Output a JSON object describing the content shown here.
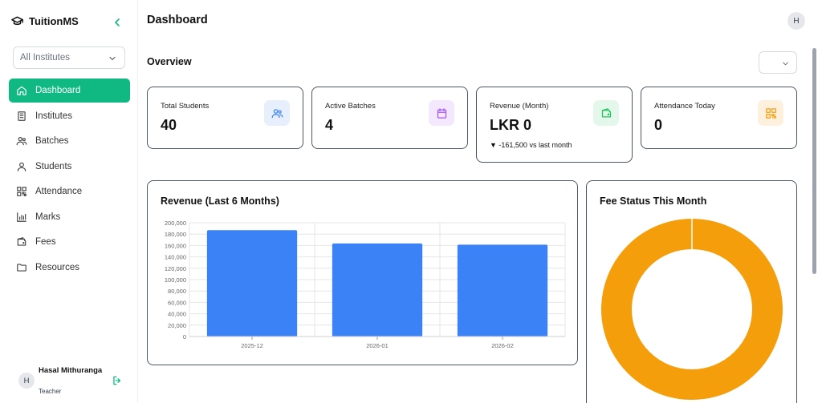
{
  "brand": {
    "name": "TuitionMS"
  },
  "sidebar": {
    "institute_select": {
      "value": "All Institutes"
    },
    "items": [
      {
        "label": "Dashboard",
        "icon": "home-icon",
        "active": true
      },
      {
        "label": "Institutes",
        "icon": "building-icon"
      },
      {
        "label": "Batches",
        "icon": "users-icon"
      },
      {
        "label": "Students",
        "icon": "user-icon"
      },
      {
        "label": "Attendance",
        "icon": "qr-icon"
      },
      {
        "label": "Marks",
        "icon": "bar-chart-icon"
      },
      {
        "label": "Fees",
        "icon": "wallet-icon"
      },
      {
        "label": "Resources",
        "icon": "folder-icon"
      }
    ],
    "user": {
      "initial": "H",
      "name": "Hasal Mithuranga",
      "role": "Teacher"
    }
  },
  "header": {
    "title": "Dashboard",
    "avatar_initial": "H"
  },
  "overview": {
    "title": "Overview",
    "select_value": ""
  },
  "stats": [
    {
      "label": "Total Students",
      "value": "40",
      "icon": "users-icon",
      "accent": "#3b82f6"
    },
    {
      "label": "Active Batches",
      "value": "4",
      "icon": "calendar-icon",
      "accent": "#a855f7"
    },
    {
      "label": "Revenue (Month)",
      "value": "LKR 0",
      "sub": "▼ -161,500 vs last month",
      "icon": "wallet-icon",
      "accent": "#22c55e"
    },
    {
      "label": "Attendance Today",
      "value": "0",
      "icon": "qr-icon",
      "accent": "#f59e0b"
    }
  ],
  "revenue_panel": {
    "title": "Revenue (Last 6 Months)"
  },
  "fee_panel": {
    "title": "Fee Status This Month"
  },
  "colors": {
    "primary": "#10b981",
    "bar": "#3b82f6",
    "donut": "#f59e0b"
  },
  "chart_data": [
    {
      "type": "bar",
      "title": "Revenue (Last 6 Months)",
      "categories": [
        "2025-12",
        "2026-01",
        "2026-02"
      ],
      "values": [
        187000,
        163500,
        161500
      ],
      "ylim": [
        0,
        200000
      ],
      "yticks": [
        "0",
        "20,000",
        "40,000",
        "60,000",
        "80,000",
        "100,000",
        "120,000",
        "140,000",
        "160,000",
        "180,000",
        "200,000"
      ],
      "grid": true,
      "color": "#3b82f6"
    },
    {
      "type": "pie",
      "title": "Fee Status This Month",
      "values": [
        100
      ],
      "colors": [
        "#f59e0b"
      ]
    }
  ]
}
